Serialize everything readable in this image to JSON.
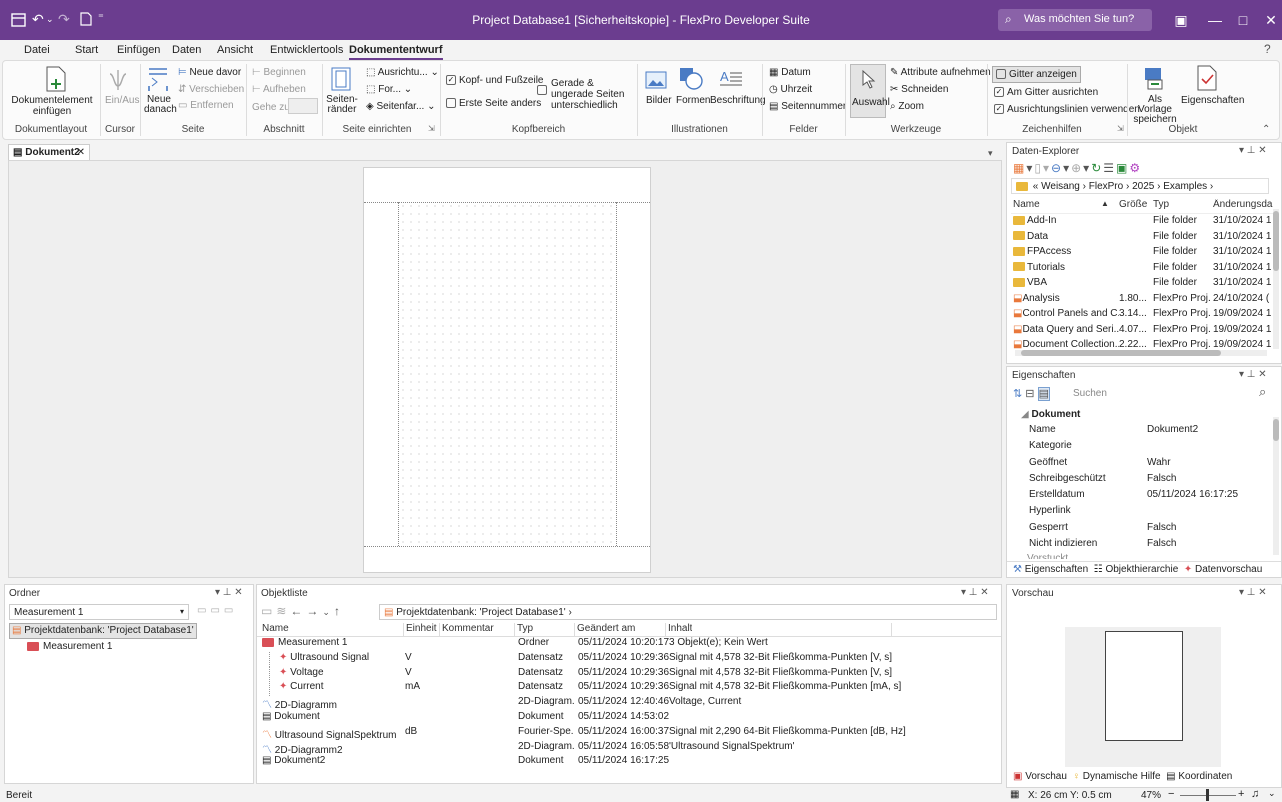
{
  "window": {
    "title": "Project Database1 [Sicherheitskopie] - FlexPro Developer Suite",
    "search_placeholder": "Was möchten Sie tun?"
  },
  "menu": [
    "Datei",
    "Start",
    "Einfügen",
    "Daten",
    "Ansicht",
    "Entwicklertools",
    "Dokumententwurf"
  ],
  "ribbon": {
    "dokumentelement": "Dokumentelement einfügen",
    "einaus": "Ein/Aus",
    "neue_danach": "Neue danach",
    "neue_davor": "Neue davor",
    "verschieben": "Verschieben",
    "entfernen": "Entfernen",
    "beginnen": "Beginnen",
    "aufheben": "Aufheben",
    "gehe_zu": "Gehe zu:",
    "seitenraender": "Seiten- ränder",
    "ausrichtung": "Ausrichtu...",
    "format": "For...",
    "seitenfarbe": "Seitenfar...",
    "kopf_fusszeile": "Kopf- und Fußzeile",
    "erste_seite": "Erste Seite anders",
    "gerade_ungerade": "Gerade & ungerade Seiten unterschiedlich",
    "bilder": "Bilder",
    "formen": "Formen",
    "beschriftung": "Beschriftung",
    "datum": "Datum",
    "uhrzeit": "Uhrzeit",
    "seitennummer": "Seitennummer",
    "auswahl": "Auswahl",
    "attribute": "Attribute aufnehmen",
    "schneiden": "Schneiden",
    "zoom": "Zoom",
    "gitter_anzeigen": "Gitter anzeigen",
    "am_gitter": "Am Gitter ausrichten",
    "ausrichtungslinien": "Ausrichtungslinien verwenden",
    "als_vorlage": "Als Vorlage speichern",
    "eigenschaften": "Eigenschaften",
    "groups": {
      "dokumentlayout": "Dokumentlayout",
      "cursor": "Cursor",
      "seite": "Seite",
      "abschnitt": "Abschnitt",
      "seite_einrichten": "Seite einrichten",
      "kopfbereich": "Kopfbereich",
      "illustrationen": "Illustrationen",
      "felder": "Felder",
      "werkzeuge": "Werkzeuge",
      "zeichenhilfen": "Zeichenhilfen",
      "objekt": "Objekt"
    }
  },
  "doc_tab": "Dokument2",
  "explorer": {
    "title": "Daten-Explorer",
    "breadcrumb": [
      "Weisang",
      "FlexPro",
      "2025",
      "Examples"
    ],
    "columns": [
      "Name",
      "Größe",
      "Typ",
      "Änderungsda"
    ],
    "rows": [
      {
        "name": "Add-In",
        "size": "",
        "type": "File folder",
        "date": "31/10/2024 1",
        "kind": "folder"
      },
      {
        "name": "Data",
        "size": "",
        "type": "File folder",
        "date": "31/10/2024 1",
        "kind": "folder"
      },
      {
        "name": "FPAccess",
        "size": "",
        "type": "File folder",
        "date": "31/10/2024 1",
        "kind": "folder"
      },
      {
        "name": "Tutorials",
        "size": "",
        "type": "File folder",
        "date": "31/10/2024 1",
        "kind": "folder"
      },
      {
        "name": "VBA",
        "size": "",
        "type": "File folder",
        "date": "31/10/2024 1",
        "kind": "folder"
      },
      {
        "name": "Analysis",
        "size": "1.80...",
        "type": "FlexPro Proj...",
        "date": "24/10/2024 (",
        "kind": "project"
      },
      {
        "name": "Control Panels and C...",
        "size": "3.14...",
        "type": "FlexPro Proj...",
        "date": "19/09/2024 1",
        "kind": "project"
      },
      {
        "name": "Data Query and Seri...",
        "size": "4.07...",
        "type": "FlexPro Proj...",
        "date": "19/09/2024 1",
        "kind": "project"
      },
      {
        "name": "Document Collection...",
        "size": "2.22...",
        "type": "FlexPro Proj...",
        "date": "19/09/2024 1",
        "kind": "project"
      }
    ]
  },
  "properties": {
    "title": "Eigenschaften",
    "search_placeholder": "Suchen",
    "section": "Dokument",
    "rows": [
      {
        "k": "Name",
        "v": "Dokument2"
      },
      {
        "k": "Kategorie",
        "v": ""
      },
      {
        "k": "Geöffnet",
        "v": "Wahr"
      },
      {
        "k": "Schreibgeschützt",
        "v": "Falsch"
      },
      {
        "k": "Erstelldatum",
        "v": "05/11/2024 16:17:25"
      },
      {
        "k": "Hyperlink",
        "v": ""
      },
      {
        "k": "Gesperrt",
        "v": "Falsch"
      },
      {
        "k": "Nicht indizieren",
        "v": "Falsch"
      }
    ],
    "tabs": [
      "Eigenschaften",
      "Objekthierarchie",
      "Datenvorschau"
    ]
  },
  "folder_panel": {
    "title": "Ordner",
    "combo_value": "Measurement 1",
    "tree": [
      "Projektdatenbank: 'Project Database1'",
      "Measurement 1"
    ]
  },
  "objectlist": {
    "title": "Objektliste",
    "path": "Projektdatenbank: 'Project Database1'",
    "columns": [
      "Name",
      "Einheit",
      "Kommentar",
      "Typ",
      "Geändert am",
      "Inhalt"
    ],
    "rows": [
      {
        "name": "Measurement 1",
        "unit": "",
        "type": "Ordner",
        "date": "05/11/2024 10:20:17",
        "content": "3 Objekt(e); Kein Wert",
        "indent": 0,
        "icon": "folder"
      },
      {
        "name": "Ultrasound Signal",
        "unit": "V",
        "type": "Datensatz",
        "date": "05/11/2024 10:29:36",
        "content": "Signal mit 4,578 32-Bit Fließkomma-Punkten [V, s]",
        "indent": 1,
        "icon": "dataset"
      },
      {
        "name": "Voltage",
        "unit": "V",
        "type": "Datensatz",
        "date": "05/11/2024 10:29:36",
        "content": "Signal mit 4,578 32-Bit Fließkomma-Punkten [V, s]",
        "indent": 1,
        "icon": "dataset"
      },
      {
        "name": "Current",
        "unit": "mA",
        "type": "Datensatz",
        "date": "05/11/2024 10:29:36",
        "content": "Signal mit 4,578 32-Bit Fließkomma-Punkten [mA, s]",
        "indent": 1,
        "icon": "dataset"
      },
      {
        "name": "2D-Diagramm",
        "unit": "",
        "type": "2D-Diagram...",
        "date": "05/11/2024 12:40:46",
        "content": "Voltage, Current",
        "indent": 0,
        "icon": "diagram"
      },
      {
        "name": "Dokument",
        "unit": "",
        "type": "Dokument",
        "date": "05/11/2024 14:53:02",
        "content": "",
        "indent": 0,
        "icon": "document"
      },
      {
        "name": "Ultrasound SignalSpektrum",
        "unit": "dB",
        "type": "Fourier-Spe...",
        "date": "05/11/2024 16:00:37",
        "content": "Signal mit 2,290 64-Bit Fließkomma-Punkten [dB, Hz]",
        "indent": 0,
        "icon": "spectrum"
      },
      {
        "name": "2D-Diagramm2",
        "unit": "",
        "type": "2D-Diagram...",
        "date": "05/11/2024 16:05:58",
        "content": "'Ultrasound SignalSpektrum'",
        "indent": 0,
        "icon": "diagram"
      },
      {
        "name": "Dokument2",
        "unit": "",
        "type": "Dokument",
        "date": "05/11/2024 16:17:25",
        "content": "",
        "indent": 0,
        "icon": "document"
      }
    ]
  },
  "preview": {
    "title": "Vorschau",
    "tabs": [
      "Vorschau",
      "Dynamische Hilfe",
      "Koordinaten"
    ]
  },
  "status": {
    "left": "Bereit",
    "coords": "X: 26 cm Y: 0.5 cm",
    "zoom": "47%"
  },
  "colors": {
    "accent": "#6b3d8f",
    "folder": "#e9b83b",
    "red": "#d94f56"
  }
}
